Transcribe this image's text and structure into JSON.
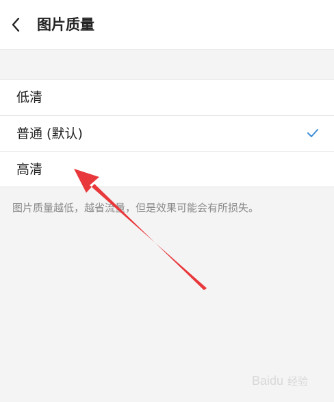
{
  "header": {
    "title": "图片质量",
    "back_icon": "chevron-left-icon"
  },
  "quality_options": [
    {
      "label": "低清",
      "selected": false
    },
    {
      "label": "普通 (默认)",
      "selected": true
    },
    {
      "label": "高清",
      "selected": false
    }
  ],
  "selected_check_color": "#3b8ed8",
  "note": "图片质量越低，越省流量，但是效果可能会有所损失。",
  "annotation_arrow_color": "#e8383b",
  "watermark": "Baidu 经验"
}
